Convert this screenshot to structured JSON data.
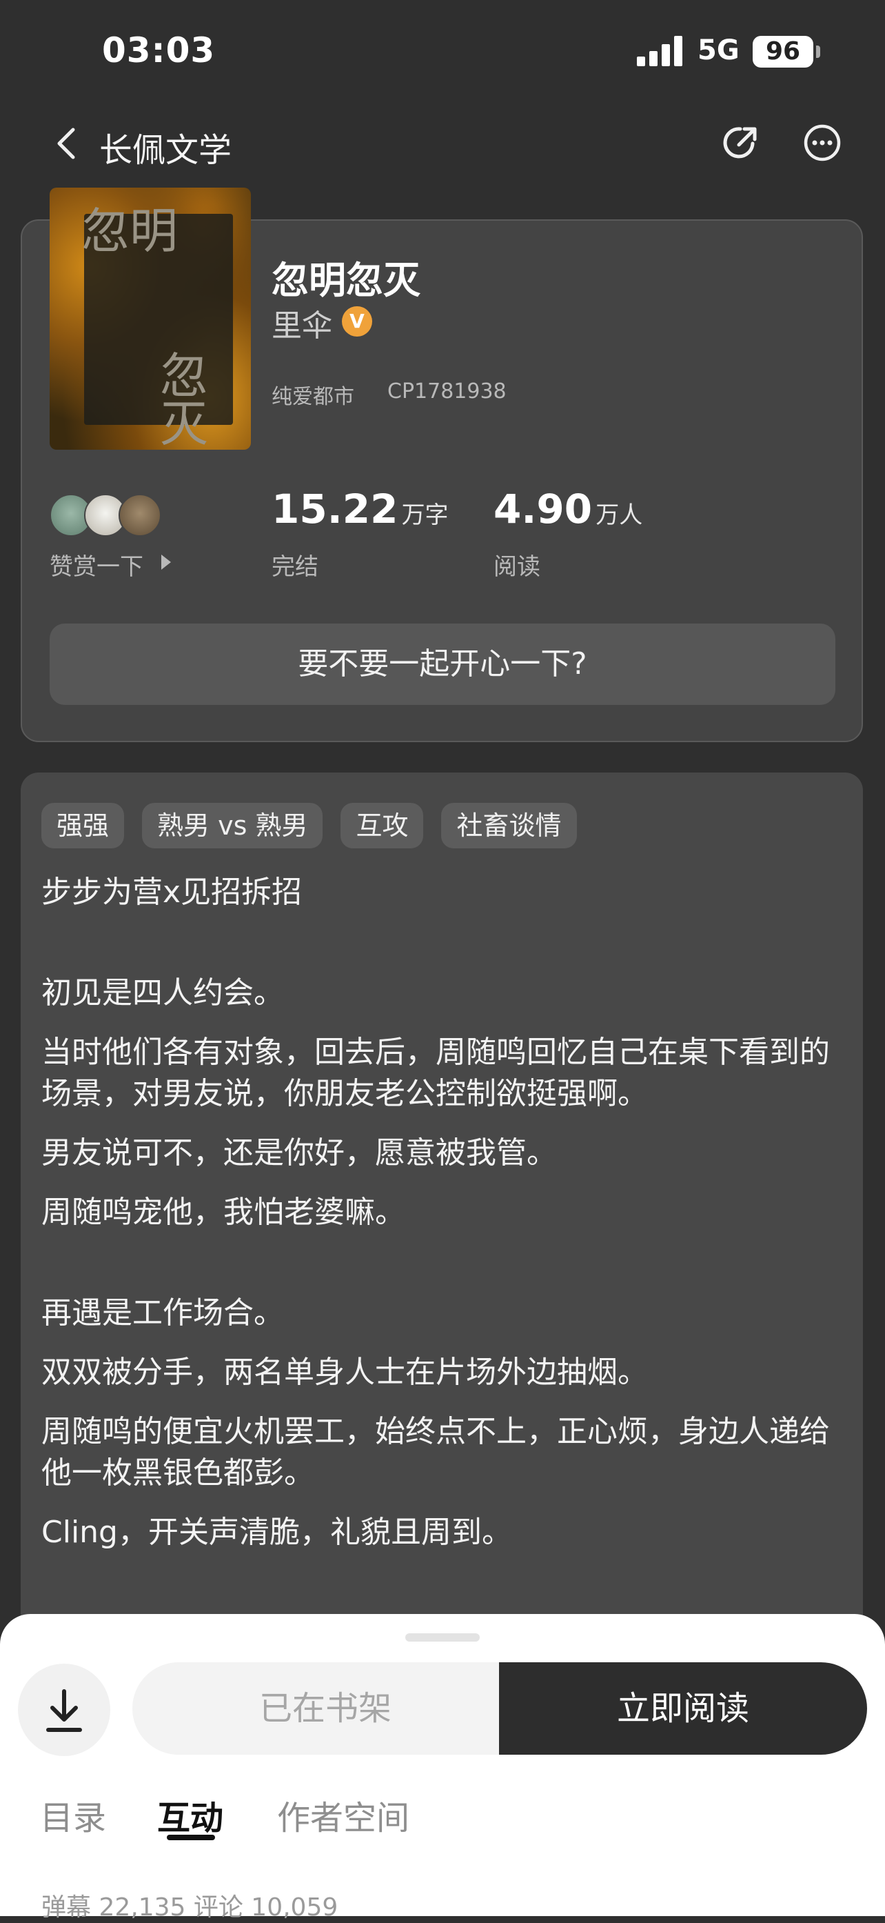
{
  "status_bar": {
    "time": "03:03",
    "network": "5G",
    "battery": "96"
  },
  "nav": {
    "title": "长佩文学"
  },
  "book": {
    "cover_text_top": "忽明",
    "cover_text_bottom": "忽灭",
    "title": "忽明忽灭",
    "author": "里伞",
    "author_badge": "V",
    "category": "纯爱都市",
    "cp": "CP1781938"
  },
  "tip": {
    "label": "赞赏一下"
  },
  "stats": [
    {
      "number": "15.22",
      "unit": "万字",
      "label": "完结"
    },
    {
      "number": "4.90",
      "unit": "万人",
      "label": "阅读"
    }
  ],
  "slogan": "要不要一起开心一下?",
  "tags": [
    "强强",
    "熟男 vs 熟男",
    "互攻",
    "社畜谈情"
  ],
  "description": [
    "步步为营x见招拆招",
    "初见是四人约会。",
    "当时他们各有对象，回去后，周随鸣回忆自己在桌下看到的场景，对男友说，你朋友老公控制欲挺强啊。",
    "男友说可不，还是你好，愿意被我管。",
    "周随鸣宠他，我怕老婆嘛。",
    "再遇是工作场合。",
    "双双被分手，两名单身人士在片场外边抽烟。",
    "周随鸣的便宜火机罢工，始终点不上，正心烦，身边人递给他一枚黑银色都彭。",
    "Cling，开关声清脆，礼貌且周到。"
  ],
  "actions": {
    "shelf": "已在书架",
    "read": "立即阅读"
  },
  "tabs": [
    "目录",
    "互动",
    "作者空间"
  ],
  "counts": "弹幕 22,135  评论 10,059",
  "colors": {
    "background": "#2f2f2f",
    "card": "#444444",
    "badge": "#f0a23a",
    "read_button": "#2d2d2d"
  }
}
